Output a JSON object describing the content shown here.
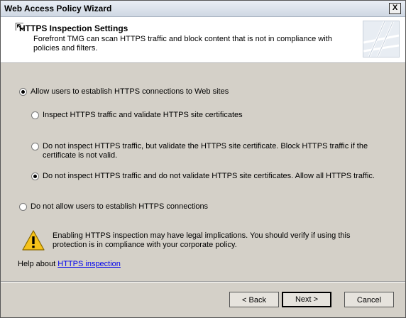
{
  "window": {
    "title": "Web Access Policy Wizard",
    "close_label": "X"
  },
  "header": {
    "title": "HTTPS Inspection Settings",
    "description": "Forefront TMG can scan HTTPS traffic and block content that is not in compliance with policies and filters."
  },
  "options": {
    "allow": "Allow users to establish HTTPS connections to Web sites",
    "inspect": "Inspect HTTPS traffic and validate HTTPS site certificates",
    "validate_only": "Do not inspect HTTPS traffic, but validate the HTTPS site certificate. Block HTTPS traffic if the certificate is not valid.",
    "allow_all": "Do not inspect HTTPS traffic and do not validate HTTPS site certificates. Allow all HTTPS traffic.",
    "deny": "Do not allow users to establish HTTPS connections"
  },
  "warning": "Enabling HTTPS inspection may have legal implications. You should verify if using this protection is in compliance with your corporate policy.",
  "help": {
    "prefix": "Help about ",
    "link": "HTTPS inspection"
  },
  "buttons": {
    "back": "< Back",
    "next": "Next >",
    "cancel": "Cancel"
  },
  "colors": {
    "dialog_bg": "#d4d0c8",
    "link": "#0000ee",
    "warning_yellow": "#f6c21a"
  }
}
